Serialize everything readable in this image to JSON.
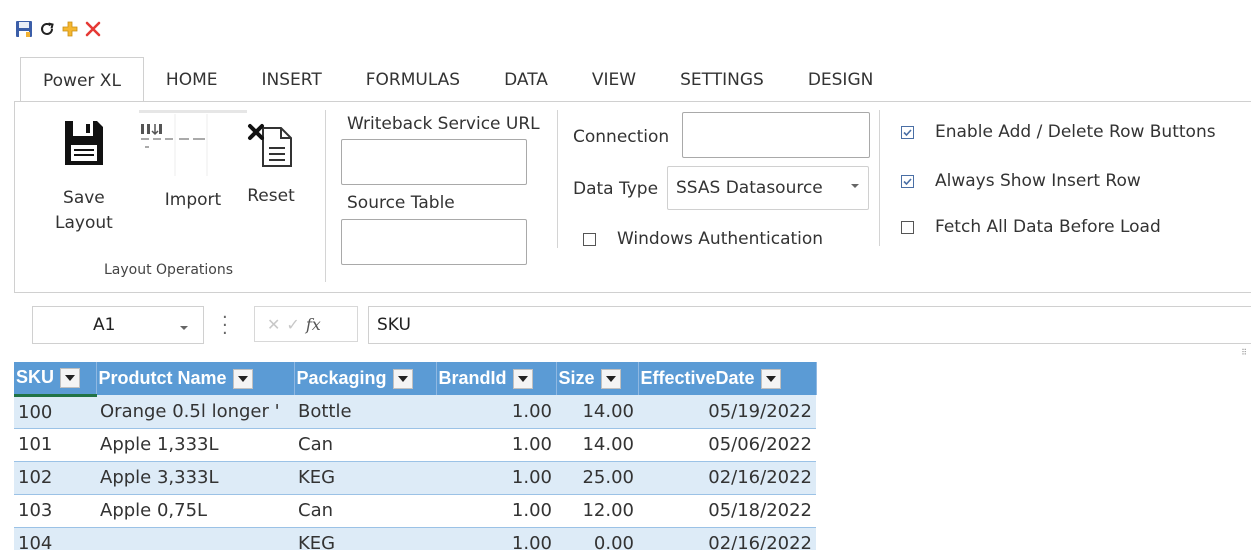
{
  "quick_access": {
    "icons": [
      "save-icon",
      "refresh-icon",
      "add-icon",
      "delete-icon"
    ]
  },
  "tabs": [
    {
      "label": "Power XL",
      "active": true
    },
    {
      "label": "HOME"
    },
    {
      "label": "INSERT"
    },
    {
      "label": "FORMULAS"
    },
    {
      "label": "DATA"
    },
    {
      "label": "VIEW"
    },
    {
      "label": "SETTINGS"
    },
    {
      "label": "DESIGN"
    }
  ],
  "ribbon": {
    "layout_ops": {
      "save_label_1": "Save",
      "save_label_2": "Layout",
      "import_label": "Import",
      "reset_label": "Reset",
      "caption": "Layout Operations"
    },
    "writeback": {
      "url_label": "Writeback Service URL",
      "url_value": "",
      "source_label": "Source Table",
      "source_value": ""
    },
    "connection": {
      "connection_label": "Connection",
      "connection_value": "",
      "data_type_label": "Data Type",
      "data_type_value": "SSAS Datasource",
      "windows_auth_label": "Windows Authentication",
      "windows_auth_checked": false
    },
    "options": {
      "enable_add_delete_label": "Enable Add / Delete Row Buttons",
      "enable_add_delete_checked": true,
      "always_show_insert_label": "Always Show Insert Row",
      "always_show_insert_checked": true,
      "fetch_all_label": "Fetch All Data Before Load",
      "fetch_all_checked": false
    }
  },
  "formula_bar": {
    "cell_ref": "A1",
    "fx": "fx",
    "value": "SKU"
  },
  "grid": {
    "columns": [
      "SKU",
      "Produtct Name",
      "Packaging",
      "BrandId",
      "Size",
      "EffectiveDate"
    ],
    "rows": [
      [
        "100",
        "Orange 0.5l longer '",
        "Bottle",
        "1.00",
        "14.00",
        "05/19/2022"
      ],
      [
        "101",
        "Apple 1,333L",
        "Can",
        "1.00",
        "14.00",
        "05/06/2022"
      ],
      [
        "102",
        "Apple 3,333L",
        "KEG",
        "1.00",
        "25.00",
        "02/16/2022"
      ],
      [
        "103",
        "Apple 0,75L",
        "Can",
        "1.00",
        "12.00",
        "05/18/2022"
      ],
      [
        "104",
        "",
        "KEG",
        "1.00",
        "0.00",
        "02/16/2022"
      ]
    ]
  },
  "colors": {
    "header_blue": "#5b9bd5",
    "band_blue": "#ddebf7",
    "active_cell_green": "#217346"
  }
}
